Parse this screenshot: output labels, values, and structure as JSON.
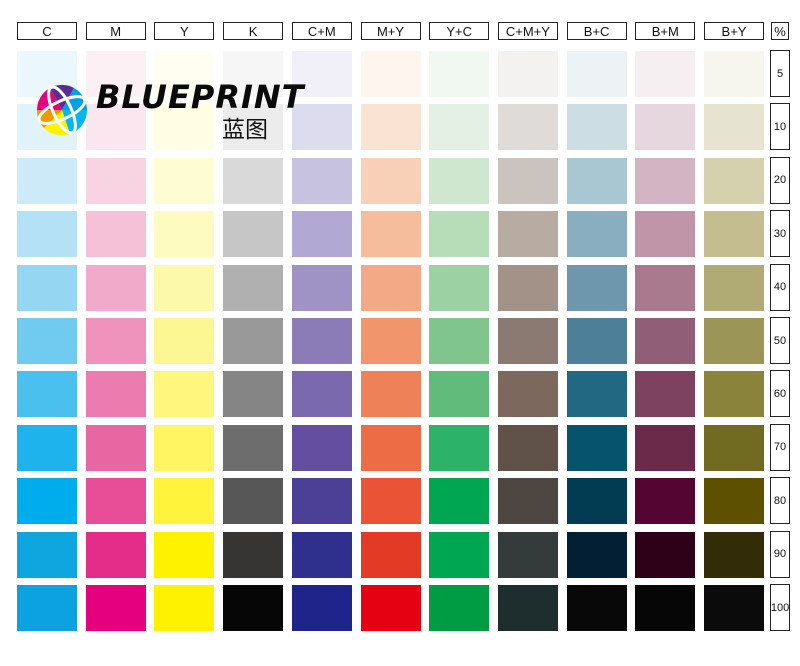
{
  "columns": [
    "C",
    "M",
    "Y",
    "K",
    "C+M",
    "M+Y",
    "Y+C",
    "C+M+Y",
    "B+C",
    "B+M",
    "B+Y"
  ],
  "percent_header": "%",
  "percent_rows": [
    "5",
    "10",
    "20",
    "30",
    "40",
    "50",
    "60",
    "70",
    "80",
    "90",
    "100"
  ],
  "logo": {
    "brand": "BLUEPRINT",
    "chinese": "蓝图"
  },
  "grid_colors": [
    [
      "#eaf7fd",
      "#fdf0f5",
      "#fffef0",
      "#f6f6f6",
      "#f1f0f8",
      "#fef5ee",
      "#f1f8f1",
      "#f4f2f1",
      "#edf2f5",
      "#f5eff1",
      "#f6f6ee"
    ],
    [
      "#e0f3fb",
      "#fbe5ee",
      "#fffde4",
      "#ececec",
      "#dddbee",
      "#fbe3d4",
      "#e3f0e3",
      "#dedbd8",
      "#cddde4",
      "#e6d6dd",
      "#e6e4d1"
    ],
    [
      "#cdeaf9",
      "#f8d4e2",
      "#fefcd2",
      "#d9d9d9",
      "#c7c2e0",
      "#f8d0b7",
      "#cfe7cf",
      "#cbc3bd",
      "#a9c6d3",
      "#d3b4c2",
      "#d5d1af"
    ],
    [
      "#b4e1f6",
      "#f4c1d7",
      "#fdfbc0",
      "#c6c6c6",
      "#b1a9d3",
      "#f5bd9c",
      "#b7ddb8",
      "#b7aba2",
      "#88aec0",
      "#c095a8",
      "#c3bd8f"
    ],
    [
      "#95d6f3",
      "#f2aacb",
      "#fdf9aa",
      "#b0b0b0",
      "#9f92c5",
      "#f3a986",
      "#9cd2a3",
      "#a39287",
      "#6e97ad",
      "#a97a8d",
      "#b0aa75"
    ],
    [
      "#71caf0",
      "#ef93bd",
      "#fdf793",
      "#999999",
      "#8b7cb8",
      "#f1956d",
      "#80c58e",
      "#8a7a71",
      "#4d7f99",
      "#905e76",
      "#9b9557"
    ],
    [
      "#49c0ee",
      "#ec7bb0",
      "#fef67d",
      "#858585",
      "#7a69ad",
      "#ef8159",
      "#61bc7c",
      "#7c685d",
      "#226882",
      "#7c4260",
      "#8a833b"
    ],
    [
      "#1eb3ec",
      "#e866a2",
      "#fff563",
      "#6d6d6d",
      "#634ea0",
      "#ed6b45",
      "#2db269",
      "#605248",
      "#05536c",
      "#6b2a4a",
      "#716a21"
    ],
    [
      "#00adec",
      "#e84e97",
      "#fff33c",
      "#575757",
      "#4b3f96",
      "#ea5335",
      "#00a652",
      "#4e4741",
      "#023c52",
      "#540532",
      "#5d5000"
    ],
    [
      "#0fa6e0",
      "#e42d88",
      "#fff200",
      "#363534",
      "#2f2f8e",
      "#e33a26",
      "#00a651",
      "#333b3b",
      "#021f33",
      "#2f0119",
      "#332c08"
    ],
    [
      "#0ca2e2",
      "#e4007f",
      "#fff200",
      "#060606",
      "#1e2489",
      "#e50012",
      "#009c44",
      "#1e2d2e",
      "#080808",
      "#060606",
      "#0b0b0b"
    ]
  ]
}
